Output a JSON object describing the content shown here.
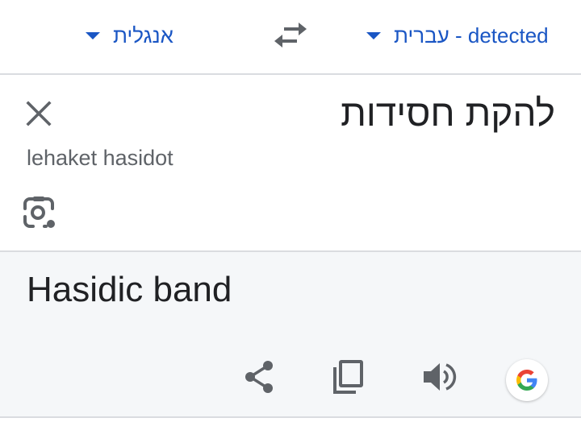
{
  "language_bar": {
    "target_language": "אנגלית",
    "source_language": "עברית - detected",
    "swap_icon": "swap-arrows-icon",
    "accent_color": "#1a56c4"
  },
  "source": {
    "text": "להקת חסידות",
    "transliteration": "lehaket hasidot",
    "clear_icon": "close-icon",
    "camera_icon": "camera-lens-icon"
  },
  "result": {
    "text": "Hasidic band",
    "background": "#f5f7f9",
    "actions": [
      "share-icon",
      "copy-icon",
      "speaker-icon",
      "google-logo-icon"
    ]
  }
}
